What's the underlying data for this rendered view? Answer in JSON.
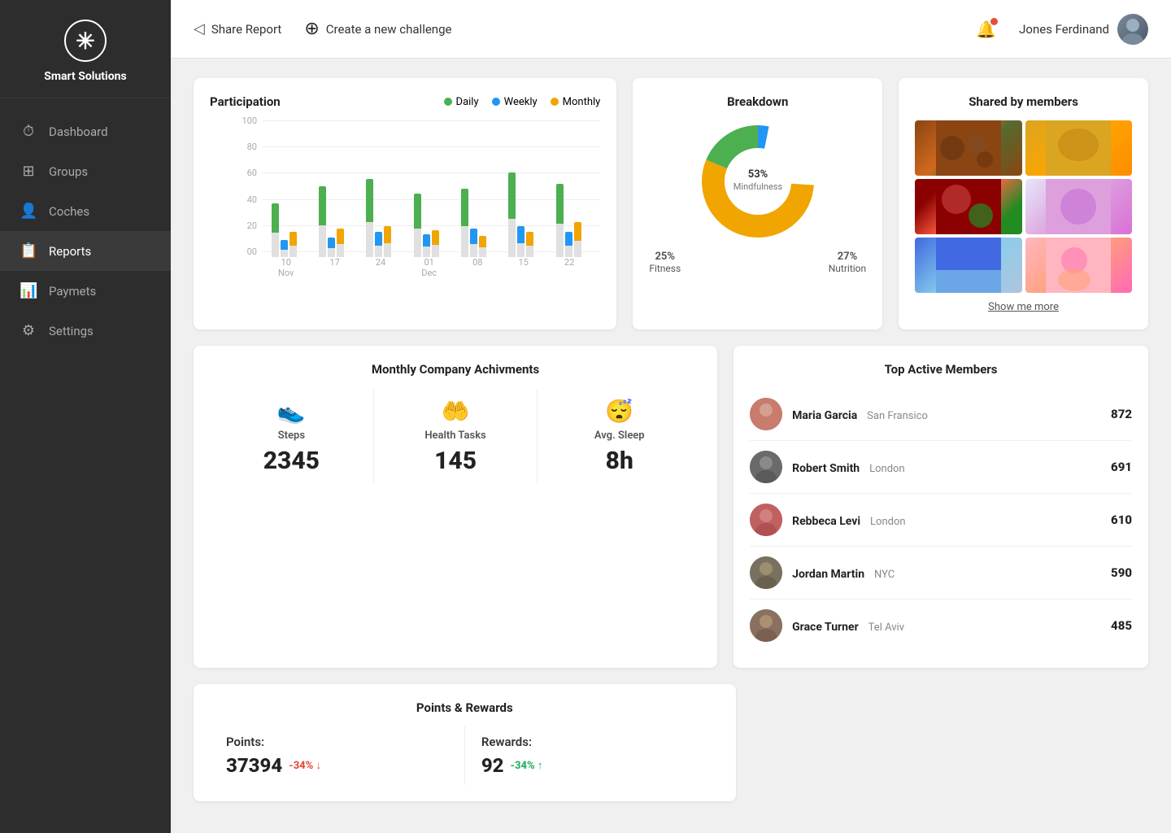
{
  "brand": {
    "logo_symbol": "✳",
    "name": "Smart Solutions"
  },
  "sidebar": {
    "items": [
      {
        "id": "dashboard",
        "label": "Dashboard",
        "icon": "⏱",
        "active": false
      },
      {
        "id": "groups",
        "label": "Groups",
        "icon": "⊞",
        "active": false
      },
      {
        "id": "coches",
        "label": "Coches",
        "icon": "👤",
        "active": false
      },
      {
        "id": "reports",
        "label": "Reports",
        "icon": "📋",
        "active": true
      },
      {
        "id": "paymets",
        "label": "Paymets",
        "icon": "📊",
        "active": false
      },
      {
        "id": "settings",
        "label": "Settings",
        "icon": "⚙",
        "active": false
      }
    ]
  },
  "header": {
    "share_report": "Share Report",
    "share_icon": "◁",
    "create_challenge": "Create a new challenge",
    "create_icon": "⊕",
    "user_name": "Jones Ferdinand"
  },
  "participation": {
    "title": "Participation",
    "legend": [
      {
        "label": "Daily",
        "color": "#4caf50"
      },
      {
        "label": "Weekly",
        "color": "#2196f3"
      },
      {
        "label": "Monthly",
        "color": "#f0a500"
      }
    ],
    "y_labels": [
      "100",
      "80",
      "60",
      "40",
      "20",
      "00"
    ],
    "bars": [
      {
        "date": "10",
        "month": "Nov",
        "daily": 38,
        "weekly": 12,
        "monthly": 18
      },
      {
        "date": "17",
        "month": "",
        "daily": 50,
        "weekly": 14,
        "monthly": 20
      },
      {
        "date": "24",
        "month": "",
        "daily": 55,
        "weekly": 18,
        "monthly": 22
      },
      {
        "date": "01",
        "month": "Dec",
        "daily": 45,
        "weekly": 16,
        "monthly": 19
      },
      {
        "date": "08",
        "month": "",
        "daily": 48,
        "weekly": 20,
        "monthly": 15
      },
      {
        "date": "15",
        "month": "",
        "daily": 60,
        "weekly": 22,
        "monthly": 18
      },
      {
        "date": "22",
        "month": "",
        "daily": 52,
        "weekly": 18,
        "monthly": 25
      }
    ]
  },
  "breakdown": {
    "title": "Breakdown",
    "segments": [
      {
        "label": "Mindfulness",
        "percent": 53,
        "color": "#f0a500"
      },
      {
        "label": "Fitness",
        "percent": 25,
        "color": "#4caf50"
      },
      {
        "label": "Nutrition",
        "percent": 27,
        "color": "#2196f3"
      }
    ],
    "center_percent": "53%",
    "center_label": "Mindfulness",
    "top_label": "53%",
    "top_sublabel": "Mindfulness",
    "left_label": "25%",
    "left_sublabel": "Fitness",
    "right_label": "27%",
    "right_sublabel": "Nutrition"
  },
  "shared_members": {
    "title": "Shared by members",
    "show_more": "Show me more"
  },
  "achievements": {
    "title": "Monthly Company Achivments",
    "metrics": [
      {
        "icon": "👟",
        "label": "Steps",
        "value": "2345"
      },
      {
        "icon": "🤲",
        "label": "Health Tasks",
        "value": "145"
      },
      {
        "icon": "😴",
        "label": "Avg. Sleep",
        "value": "8h"
      }
    ]
  },
  "top_members": {
    "title": "Top Active Members",
    "members": [
      {
        "name": "Maria Garcia",
        "location": "San Fransico",
        "score": "872",
        "av": "av-maria"
      },
      {
        "name": "Robert Smith",
        "location": "London",
        "score": "691",
        "av": "av-robert"
      },
      {
        "name": "Rebbeca Levi",
        "location": "London",
        "score": "610",
        "av": "av-rebbeca"
      },
      {
        "name": "Jordan Martin",
        "location": "NYC",
        "score": "590",
        "av": "av-jordan"
      },
      {
        "name": "Grace Turner",
        "location": "Tel Aviv",
        "score": "485",
        "av": "av-grace"
      }
    ]
  },
  "points_rewards": {
    "title": "Points & Rewards",
    "points_label": "Points:",
    "points_value": "37394",
    "points_change": "-34% ↓",
    "rewards_label": "Rewards:",
    "rewards_value": "92",
    "rewards_change": "-34% ↑"
  }
}
